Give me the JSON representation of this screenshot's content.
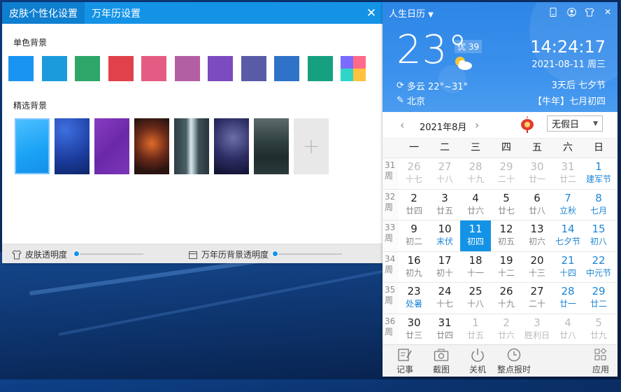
{
  "skin": {
    "tabs": [
      "皮肤个性化设置",
      "万年历设置"
    ],
    "solid_title": "单色背景",
    "featured_title": "精选背景",
    "solid_colors": [
      "#1a94f2",
      "#1b9bdb",
      "#2ea66a",
      "#e0414a",
      "#e45c83",
      "#b25fa4",
      "#7b4bbf",
      "#5a5ba6",
      "#2f73c8",
      "#17a080"
    ],
    "skin_opacity_label": "皮肤透明度",
    "cal_opacity_label": "万年历背景透明度",
    "skin_opacity": 0,
    "cal_opacity": 0
  },
  "cal": {
    "app_title": "人生日历",
    "temp": "23°",
    "aqi": "优 39",
    "weather": "多云 22°~31°",
    "city": "北京",
    "time": "14:24:17",
    "date": "2021-08-11 周三",
    "countdown": "3天后 七夕节",
    "lunar": "【牛年】七月初四",
    "month": "2021年8月",
    "holiday": "无假日",
    "weekdays": [
      "一",
      "二",
      "三",
      "四",
      "五",
      "六",
      "日"
    ],
    "weeks": [
      {
        "w": "31",
        "wl": "周",
        "days": [
          [
            "26",
            "十七",
            "out"
          ],
          [
            "27",
            "十八",
            "out"
          ],
          [
            "28",
            "十九",
            "out"
          ],
          [
            "29",
            "二十",
            "out"
          ],
          [
            "30",
            "廿一",
            "out"
          ],
          [
            "31",
            "廿二",
            "out"
          ],
          [
            "1",
            "建军节",
            "we"
          ]
        ]
      },
      {
        "w": "32",
        "wl": "周",
        "days": [
          [
            "2",
            "廿四",
            ""
          ],
          [
            "3",
            "廿五",
            ""
          ],
          [
            "4",
            "廿六",
            ""
          ],
          [
            "5",
            "廿七",
            ""
          ],
          [
            "6",
            "廿八",
            ""
          ],
          [
            "7",
            "立秋",
            "we"
          ],
          [
            "8",
            "七月",
            "we"
          ]
        ]
      },
      {
        "w": "33",
        "wl": "周",
        "days": [
          [
            "9",
            "初二",
            ""
          ],
          [
            "10",
            "末伏",
            "hl"
          ],
          [
            "11",
            "初四",
            "today"
          ],
          [
            "12",
            "初五",
            ""
          ],
          [
            "13",
            "初六",
            ""
          ],
          [
            "14",
            "七夕节",
            "we"
          ],
          [
            "15",
            "初八",
            "we"
          ]
        ]
      },
      {
        "w": "34",
        "wl": "周",
        "days": [
          [
            "16",
            "初九",
            ""
          ],
          [
            "17",
            "初十",
            ""
          ],
          [
            "18",
            "十一",
            ""
          ],
          [
            "19",
            "十二",
            ""
          ],
          [
            "20",
            "十三",
            ""
          ],
          [
            "21",
            "十四",
            "we"
          ],
          [
            "22",
            "中元节",
            "we"
          ]
        ]
      },
      {
        "w": "35",
        "wl": "周",
        "days": [
          [
            "23",
            "处暑",
            "hl"
          ],
          [
            "24",
            "十七",
            ""
          ],
          [
            "25",
            "十八",
            ""
          ],
          [
            "26",
            "十九",
            ""
          ],
          [
            "27",
            "二十",
            ""
          ],
          [
            "28",
            "廿一",
            "we"
          ],
          [
            "29",
            "廿二",
            "we"
          ]
        ]
      },
      {
        "w": "36",
        "wl": "周",
        "days": [
          [
            "30",
            "廿三",
            ""
          ],
          [
            "31",
            "廿四",
            ""
          ],
          [
            "1",
            "廿五",
            "out"
          ],
          [
            "2",
            "廿六",
            "out"
          ],
          [
            "3",
            "胜利日",
            "out"
          ],
          [
            "4",
            "廿八",
            "out"
          ],
          [
            "5",
            "廿九",
            "out"
          ]
        ]
      }
    ],
    "toolbar": [
      "记事",
      "截图",
      "关机",
      "整点报时",
      "应用"
    ]
  }
}
